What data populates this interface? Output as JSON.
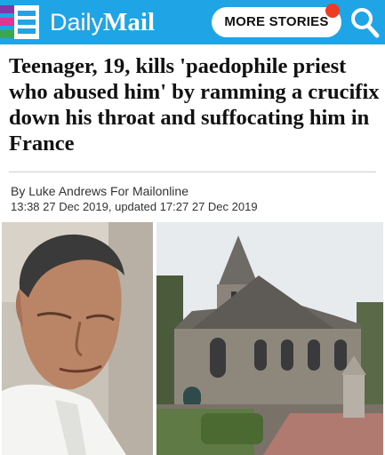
{
  "header": {
    "logo_daily": "Daily",
    "logo_mail": "Mail",
    "more_stories_label": "MORE STORIES"
  },
  "article": {
    "headline": "Teenager, 19, kills 'paedophile priest who abused him' by ramming a crucifix down his throat and suffocating him in France",
    "byline": "By Luke Andrews For Mailonline",
    "timestamp": "13:38 27 Dec 2019, updated 17:27 27 Dec 2019"
  },
  "colors": {
    "topbar": "#1fa4e6",
    "notification": "#ee3b24",
    "menu_purple": "#7e3aa9",
    "menu_pink": "#e0368f",
    "menu_green": "#3aa848"
  },
  "icons": {
    "menu": "hamburger-menu-icon",
    "search": "search-icon",
    "notification": "notification-dot-icon"
  }
}
